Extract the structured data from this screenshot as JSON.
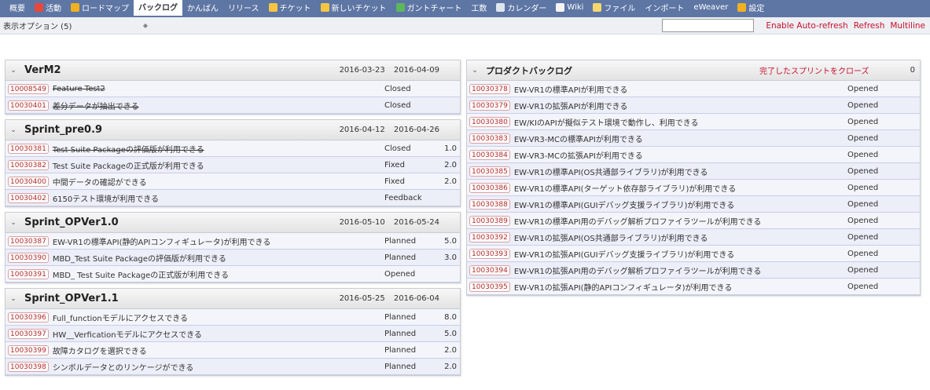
{
  "nav": [
    {
      "label": "概要",
      "icon": "",
      "color": ""
    },
    {
      "label": "活動",
      "icon": "activity-icon",
      "color": "#e8483c"
    },
    {
      "label": "ロードマップ",
      "icon": "roadmap-icon",
      "color": "#f0b020"
    },
    {
      "label": "バックログ",
      "icon": "",
      "color": "",
      "active": true
    },
    {
      "label": "かんばん",
      "icon": "",
      "color": ""
    },
    {
      "label": "リリース",
      "icon": "",
      "color": ""
    },
    {
      "label": "チケット",
      "icon": "ticket-icon",
      "color": "#f5c542"
    },
    {
      "label": "新しいチケット",
      "icon": "new-ticket-icon",
      "color": "#f5c542"
    },
    {
      "label": "ガントチャート",
      "icon": "gantt-icon",
      "color": "#5cb85c"
    },
    {
      "label": "工数",
      "icon": "",
      "color": ""
    },
    {
      "label": "カレンダー",
      "icon": "calendar-icon",
      "color": "#dfe6f0"
    },
    {
      "label": "Wiki",
      "icon": "wiki-icon",
      "color": "#f4f4f4"
    },
    {
      "label": "ファイル",
      "icon": "file-icon",
      "color": "#f5d76e"
    },
    {
      "label": "インポート",
      "icon": "",
      "color": ""
    },
    {
      "label": "eWeaver",
      "icon": "",
      "color": ""
    },
    {
      "label": "設定",
      "icon": "settings-icon",
      "color": "#f0b020"
    }
  ],
  "options": {
    "display_options": "表示オプション (5)",
    "search_value": "",
    "enable_auto_refresh": "Enable Auto-refresh",
    "refresh": "Refresh",
    "multiline": "Multiline"
  },
  "sprints": [
    {
      "name": "VerM2",
      "start": "2016-03-23",
      "end": "2016-04-09",
      "tickets": [
        {
          "id": "10008549",
          "title": "Feature Test2",
          "status": "Closed",
          "points": "",
          "closed": true
        },
        {
          "id": "10030401",
          "title": "差分データが抽出できる",
          "status": "Closed",
          "points": "",
          "closed": true
        }
      ]
    },
    {
      "name": "Sprint_pre0.9",
      "start": "2016-04-12",
      "end": "2016-04-26",
      "tickets": [
        {
          "id": "10030381",
          "title": "Test Suite Packageの評価版が利用できる",
          "status": "Closed",
          "points": "1.0",
          "closed": true
        },
        {
          "id": "10030382",
          "title": "Test Suite Packageの正式版が利用できる",
          "status": "Fixed",
          "points": "2.0"
        },
        {
          "id": "10030400",
          "title": "中間データの確認ができる",
          "status": "Fixed",
          "points": "2.0"
        },
        {
          "id": "10030402",
          "title": "6150テスト環境が利用できる",
          "status": "Feedback",
          "points": ""
        }
      ]
    },
    {
      "name": "Sprint_OPVer1.0",
      "start": "2016-05-10",
      "end": "2016-05-24",
      "tickets": [
        {
          "id": "10030387",
          "title": "EW-VR1の標準API(静的APIコンフィギュレータ)が利用できる",
          "status": "Planned",
          "points": "5.0"
        },
        {
          "id": "10030390",
          "title": "MBD_Test Suite Packageの評価版が利用できる",
          "status": "Planned",
          "points": "3.0"
        },
        {
          "id": "10030391",
          "title": "MBD_ Test Suite Packageの正式版が利用できる",
          "status": "Opened",
          "points": ""
        }
      ]
    },
    {
      "name": "Sprint_OPVer1.1",
      "start": "2016-05-25",
      "end": "2016-06-04",
      "tickets": [
        {
          "id": "10030396",
          "title": "Full_functionモデルにアクセスできる",
          "status": "Planned",
          "points": "8.0"
        },
        {
          "id": "10030397",
          "title": "HW__Verficationモデルにアクセスできる",
          "status": "Planned",
          "points": "5.0"
        },
        {
          "id": "10030399",
          "title": "故障カタログを選択できる",
          "status": "Planned",
          "points": "2.0"
        },
        {
          "id": "10030398",
          "title": "シンボルデータとのリンケージができる",
          "status": "Planned",
          "points": "2.0"
        }
      ]
    }
  ],
  "backlog": {
    "title": "プロダクトバックログ",
    "close_sprints": "完了したスプリントをクローズ",
    "count": "0",
    "tickets": [
      {
        "id": "10030378",
        "title": "EW-VR1の標準APIが利用できる",
        "status": "Opened"
      },
      {
        "id": "10030379",
        "title": "EW-VR1の拡張APIが利用できる",
        "status": "Opened"
      },
      {
        "id": "10030380",
        "title": "EW/KIのAPIが擬似テスト環境で動作し、利用できる",
        "status": "Opened"
      },
      {
        "id": "10030383",
        "title": "EW-VR3-MCの標準APIが利用できる",
        "status": "Opened"
      },
      {
        "id": "10030384",
        "title": "EW-VR3-MCの拡張APIが利用できる",
        "status": "Opened"
      },
      {
        "id": "10030385",
        "title": "EW-VR1の標準API(OS共通部ライブラリ)が利用できる",
        "status": "Opened"
      },
      {
        "id": "10030386",
        "title": "EW-VR1の標準API(ターゲット依存部ライブラリ)が利用できる",
        "status": "Opened"
      },
      {
        "id": "10030388",
        "title": "EW-VR1の標準API(GUIデバッグ支援ライブラリ)が利用できる",
        "status": "Opened"
      },
      {
        "id": "10030389",
        "title": "EW-VR1の標準API用のデバッグ解析プロファイラツールが利用できる",
        "status": "Opened"
      },
      {
        "id": "10030392",
        "title": "EW-VR1の拡張API(OS共通部ライブラリ)が利用できる",
        "status": "Opened"
      },
      {
        "id": "10030393",
        "title": "EW-VR1の拡張API(GUIデバッグ支援ライブラリ)が利用できる",
        "status": "Opened"
      },
      {
        "id": "10030394",
        "title": "EW-VR1の拡張API用のデバッグ解析プロファイラツールが利用できる",
        "status": "Opened"
      },
      {
        "id": "10030395",
        "title": "EW-VR1の拡張API(静的APIコンフィギュレータ)が利用できる",
        "status": "Opened"
      }
    ]
  }
}
